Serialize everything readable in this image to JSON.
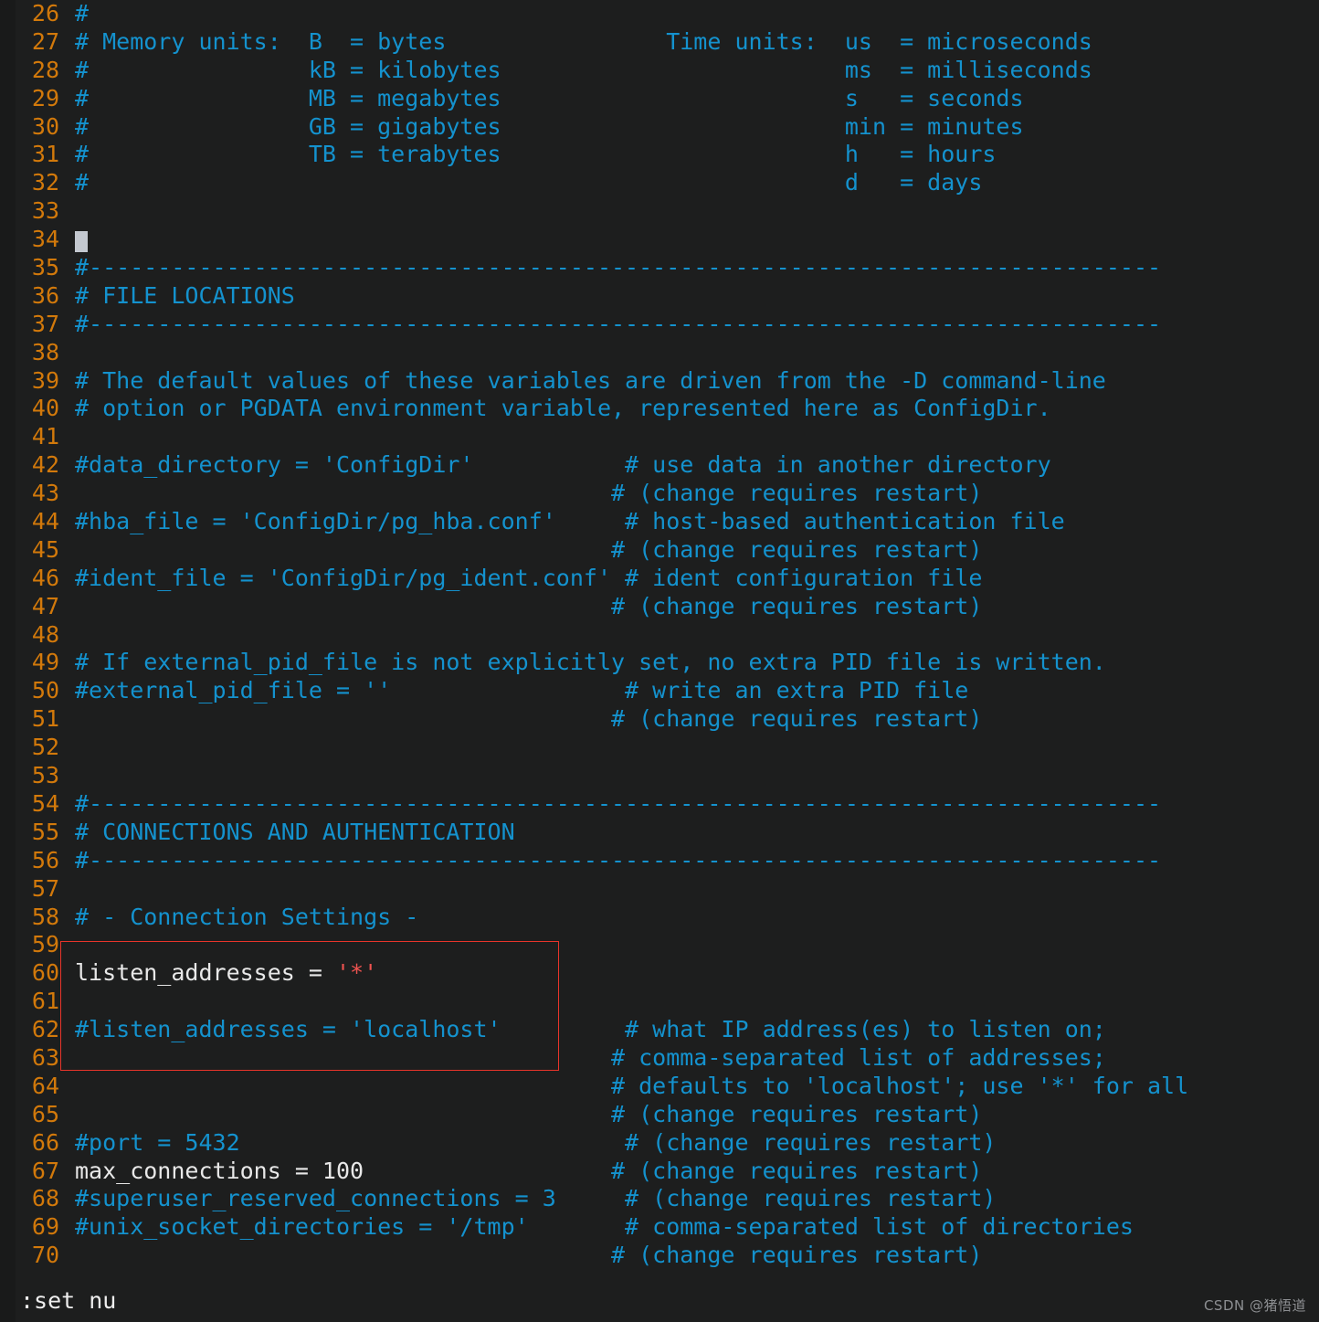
{
  "editor": {
    "name": "vim-editor",
    "filetype": "postgresql.conf",
    "background_color": "#1d1e1e",
    "line_number_color": "#d2790b",
    "comment_color": "#1492ce",
    "code_color": "#e8e8e8",
    "string_color": "#ef5350",
    "cursor_line": 34,
    "first_visible_line": 26,
    "last_visible_line": 70,
    "lines": [
      {
        "num": "26",
        "segments": [
          {
            "t": "#",
            "c": "cm"
          }
        ]
      },
      {
        "num": "27",
        "segments": [
          {
            "t": "# Memory units:  B  = bytes                Time units:  us  = microseconds",
            "c": "cm"
          }
        ]
      },
      {
        "num": "28",
        "segments": [
          {
            "t": "#                kB = kilobytes                         ms  = milliseconds",
            "c": "cm"
          }
        ]
      },
      {
        "num": "29",
        "segments": [
          {
            "t": "#                MB = megabytes                         s   = seconds",
            "c": "cm"
          }
        ]
      },
      {
        "num": "30",
        "segments": [
          {
            "t": "#                GB = gigabytes                         min = minutes",
            "c": "cm"
          }
        ]
      },
      {
        "num": "31",
        "segments": [
          {
            "t": "#                TB = terabytes                         h   = hours",
            "c": "cm"
          }
        ]
      },
      {
        "num": "32",
        "segments": [
          {
            "t": "#                                                       d   = days",
            "c": "cm"
          }
        ]
      },
      {
        "num": "33",
        "segments": []
      },
      {
        "num": "34",
        "segments": [],
        "cursor": true
      },
      {
        "num": "35",
        "segments": [
          {
            "t": "#------------------------------------------------------------------------------",
            "c": "cm"
          }
        ]
      },
      {
        "num": "36",
        "segments": [
          {
            "t": "# FILE LOCATIONS",
            "c": "cm"
          }
        ]
      },
      {
        "num": "37",
        "segments": [
          {
            "t": "#------------------------------------------------------------------------------",
            "c": "cm"
          }
        ]
      },
      {
        "num": "38",
        "segments": []
      },
      {
        "num": "39",
        "segments": [
          {
            "t": "# The default values of these variables are driven from the -D command-line",
            "c": "cm"
          }
        ]
      },
      {
        "num": "40",
        "segments": [
          {
            "t": "# option or PGDATA environment variable, represented here as ConfigDir.",
            "c": "cm"
          }
        ]
      },
      {
        "num": "41",
        "segments": []
      },
      {
        "num": "42",
        "segments": [
          {
            "t": "#data_directory = 'ConfigDir'           # use data in another directory",
            "c": "cm"
          }
        ]
      },
      {
        "num": "43",
        "segments": [
          {
            "t": "                                       # (change requires restart)",
            "c": "cm"
          }
        ]
      },
      {
        "num": "44",
        "segments": [
          {
            "t": "#hba_file = 'ConfigDir/pg_hba.conf'     # host-based authentication file",
            "c": "cm"
          }
        ]
      },
      {
        "num": "45",
        "segments": [
          {
            "t": "                                       # (change requires restart)",
            "c": "cm"
          }
        ]
      },
      {
        "num": "46",
        "segments": [
          {
            "t": "#ident_file = 'ConfigDir/pg_ident.conf' # ident configuration file",
            "c": "cm"
          }
        ]
      },
      {
        "num": "47",
        "segments": [
          {
            "t": "                                       # (change requires restart)",
            "c": "cm"
          }
        ]
      },
      {
        "num": "48",
        "segments": []
      },
      {
        "num": "49",
        "segments": [
          {
            "t": "# If external_pid_file is not explicitly set, no extra PID file is written.",
            "c": "cm"
          }
        ]
      },
      {
        "num": "50",
        "segments": [
          {
            "t": "#external_pid_file = ''                 # write an extra PID file",
            "c": "cm"
          }
        ]
      },
      {
        "num": "51",
        "segments": [
          {
            "t": "                                       # (change requires restart)",
            "c": "cm"
          }
        ]
      },
      {
        "num": "52",
        "segments": []
      },
      {
        "num": "53",
        "segments": []
      },
      {
        "num": "54",
        "segments": [
          {
            "t": "#------------------------------------------------------------------------------",
            "c": "cm"
          }
        ]
      },
      {
        "num": "55",
        "segments": [
          {
            "t": "# CONNECTIONS AND AUTHENTICATION",
            "c": "cm"
          }
        ]
      },
      {
        "num": "56",
        "segments": [
          {
            "t": "#------------------------------------------------------------------------------",
            "c": "cm"
          }
        ]
      },
      {
        "num": "57",
        "segments": []
      },
      {
        "num": "58",
        "segments": [
          {
            "t": "# - Connection Settings -",
            "c": "cm"
          }
        ]
      },
      {
        "num": "59",
        "segments": []
      },
      {
        "num": "60",
        "segments": [
          {
            "t": "listen_addresses = ",
            "c": "code"
          },
          {
            "t": "'*'",
            "c": "str"
          }
        ]
      },
      {
        "num": "61",
        "segments": []
      },
      {
        "num": "62",
        "segments": [
          {
            "t": "#listen_addresses = 'localhost'         # what IP address(es) to listen on;",
            "c": "cm"
          }
        ]
      },
      {
        "num": "63",
        "segments": [
          {
            "t": "                                       # comma-separated list of addresses;",
            "c": "cm"
          }
        ]
      },
      {
        "num": "64",
        "segments": [
          {
            "t": "                                       # defaults to 'localhost'; use '*' for all",
            "c": "cm"
          }
        ]
      },
      {
        "num": "65",
        "segments": [
          {
            "t": "                                       # (change requires restart)",
            "c": "cm"
          }
        ]
      },
      {
        "num": "66",
        "segments": [
          {
            "t": "#port = 5432                            # (change requires restart)",
            "c": "cm"
          }
        ]
      },
      {
        "num": "67",
        "segments": [
          {
            "t": "max_connections = 100",
            "c": "code"
          },
          {
            "t": "                  # (change requires restart)",
            "c": "cm"
          }
        ]
      },
      {
        "num": "68",
        "segments": [
          {
            "t": "#superuser_reserved_connections = 3     # (change requires restart)",
            "c": "cm"
          }
        ]
      },
      {
        "num": "69",
        "segments": [
          {
            "t": "#unix_socket_directories = '/tmp'       # comma-separated list of directories",
            "c": "cm"
          }
        ]
      },
      {
        "num": "70",
        "segments": [
          {
            "t": "                                       # (change requires restart)",
            "c": "cm"
          }
        ]
      }
    ]
  },
  "annotation": {
    "type": "rectangle-highlight",
    "color": "#e8342a",
    "covers_lines": "59-63",
    "highlighted_setting": "listen_addresses = '*'"
  },
  "status": {
    "command": ":set nu"
  },
  "watermark": {
    "text": "CSDN @猪悟道"
  }
}
